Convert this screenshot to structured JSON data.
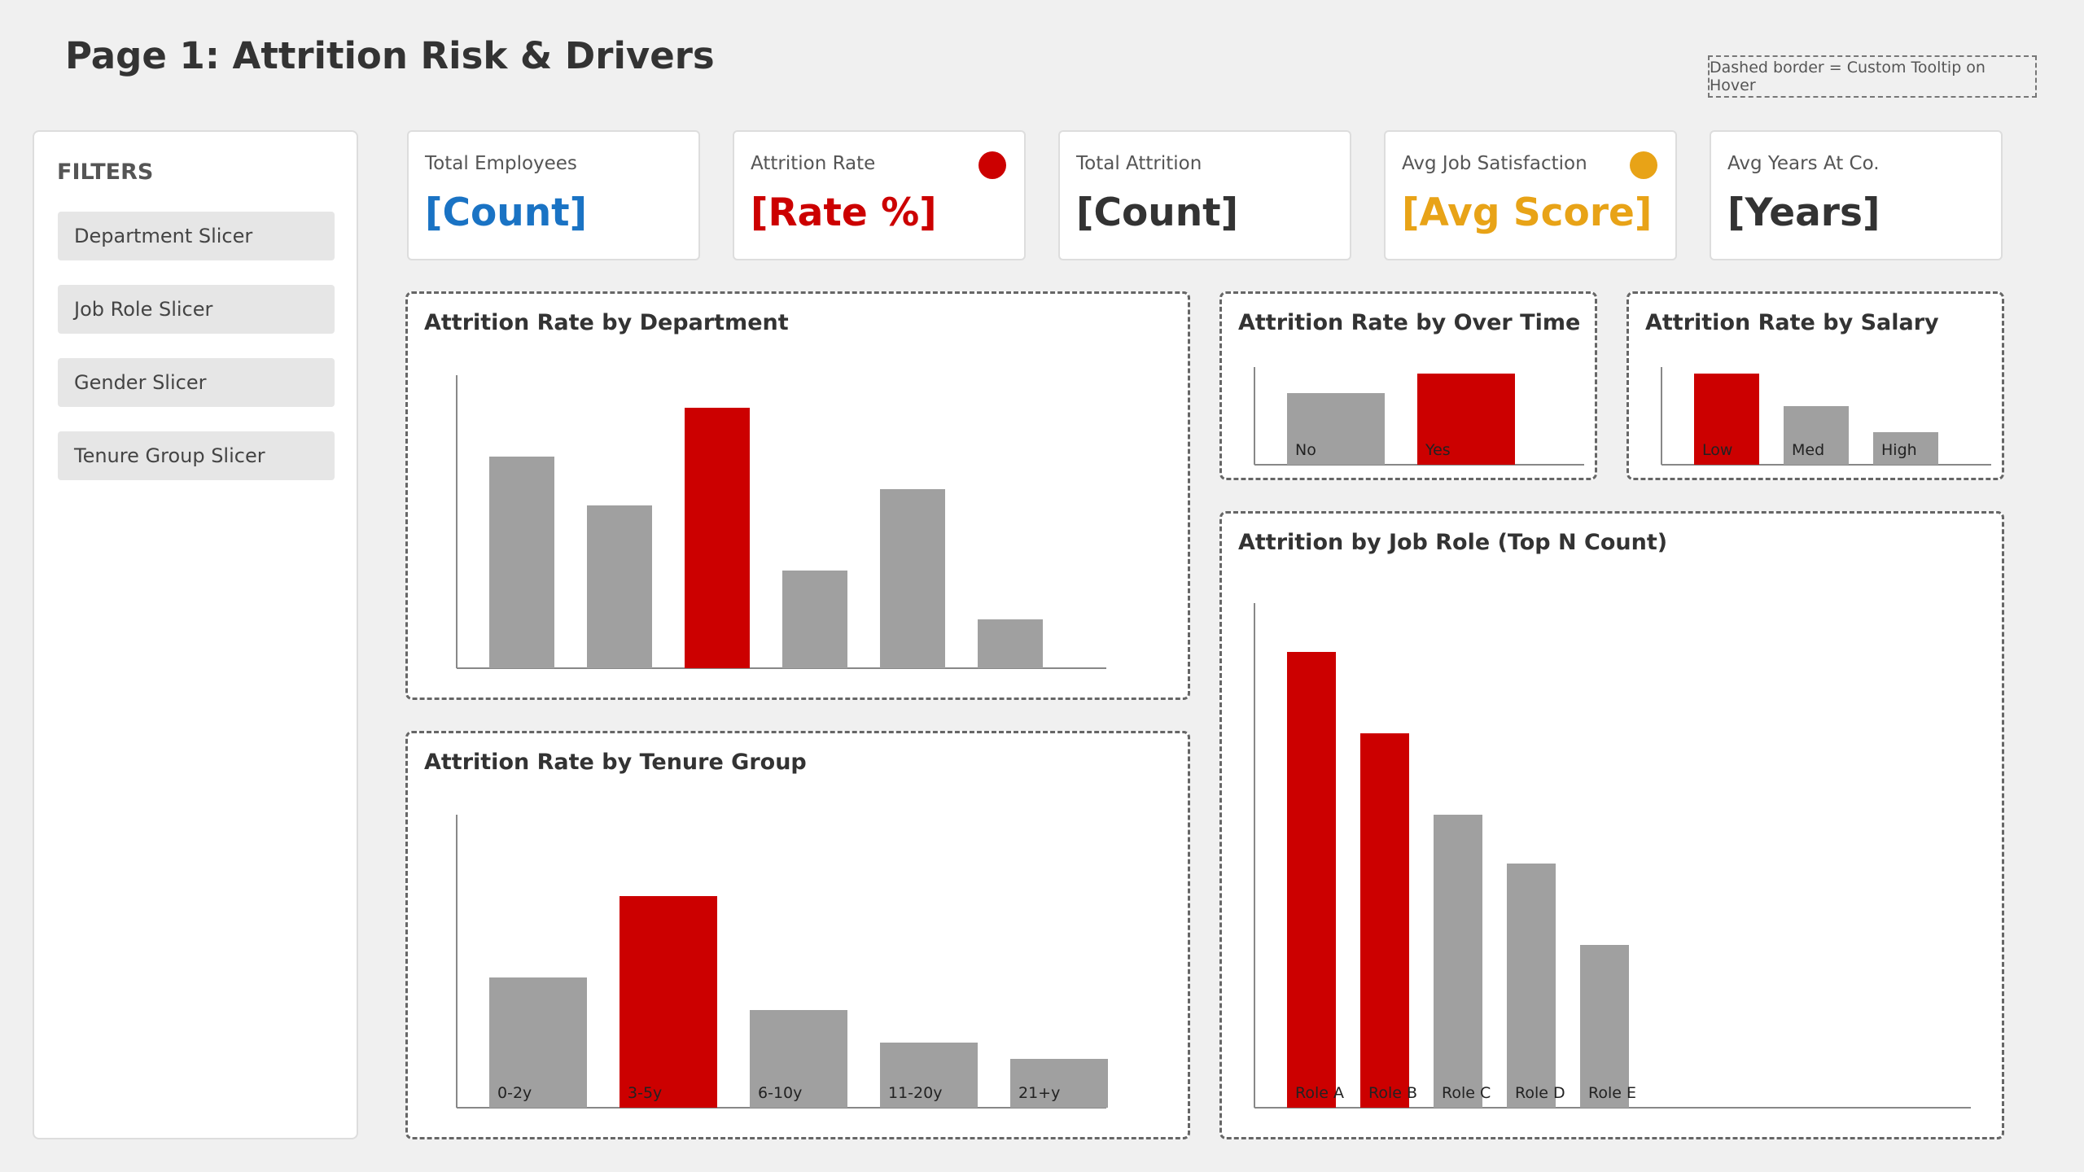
{
  "page": {
    "title": "Page 1: Attrition Risk & Drivers"
  },
  "legend_note": "Dashed border = Custom Tooltip on Hover",
  "filters": {
    "title": "FILTERS",
    "slicers": [
      "Department Slicer",
      "Job Role Slicer",
      "Gender Slicer",
      "Tenure Group Slicer"
    ]
  },
  "kpis": [
    {
      "label": "Total Employees",
      "value": "[Count]",
      "color": "#1a73c4",
      "indicator": null
    },
    {
      "label": "Attrition Rate",
      "value": "[Rate %]",
      "color": "#cc0000",
      "indicator": "#cc0000"
    },
    {
      "label": "Total Attrition",
      "value": "[Count]",
      "color": "#333333",
      "indicator": null
    },
    {
      "label": "Avg Job Satisfaction",
      "value": "[Avg Score]",
      "color": "#e8a317",
      "indicator": "#e8a317"
    },
    {
      "label": "Avg Years At Co.",
      "value": "[Years]",
      "color": "#333333",
      "indicator": null
    }
  ],
  "colors": {
    "highlight": "#cc0000",
    "neutral": "#a0a0a0",
    "axis": "#888888"
  },
  "chart_data": [
    {
      "id": "department",
      "type": "bar",
      "title": "Attrition Rate by Department",
      "categories": [
        "",
        "",
        "",
        "",
        "",
        ""
      ],
      "values": [
        65,
        50,
        80,
        30,
        55,
        15
      ],
      "highlight": [
        false,
        false,
        true,
        false,
        false,
        false
      ],
      "ylim": [
        0,
        90
      ]
    },
    {
      "id": "overtime",
      "type": "bar",
      "title": "Attrition Rate by Over Time",
      "categories": [
        "No",
        "Yes"
      ],
      "values": [
        55,
        70
      ],
      "highlight": [
        false,
        true
      ],
      "ylim": [
        0,
        75
      ]
    },
    {
      "id": "salary",
      "type": "bar",
      "title": "Attrition Rate by Salary",
      "categories": [
        "Low",
        "Med",
        "High"
      ],
      "values": [
        70,
        45,
        25
      ],
      "highlight": [
        true,
        false,
        false
      ],
      "ylim": [
        0,
        75
      ]
    },
    {
      "id": "tenure",
      "type": "bar",
      "title": "Attrition Rate by Tenure Group",
      "categories": [
        "0-2y",
        "3-5y",
        "6-10y",
        "11-20y",
        "21+y"
      ],
      "values": [
        40,
        65,
        30,
        20,
        15
      ],
      "highlight": [
        false,
        true,
        false,
        false,
        false
      ],
      "ylim": [
        0,
        90
      ]
    },
    {
      "id": "jobrole",
      "type": "bar",
      "title": "Attrition by Job Role (Top N Count)",
      "categories": [
        "Role A",
        "Role B",
        "Role C",
        "Role D",
        "Role E"
      ],
      "values": [
        140,
        115,
        90,
        75,
        50
      ],
      "highlight": [
        true,
        true,
        false,
        false,
        false
      ],
      "ylim": [
        0,
        155
      ]
    }
  ]
}
